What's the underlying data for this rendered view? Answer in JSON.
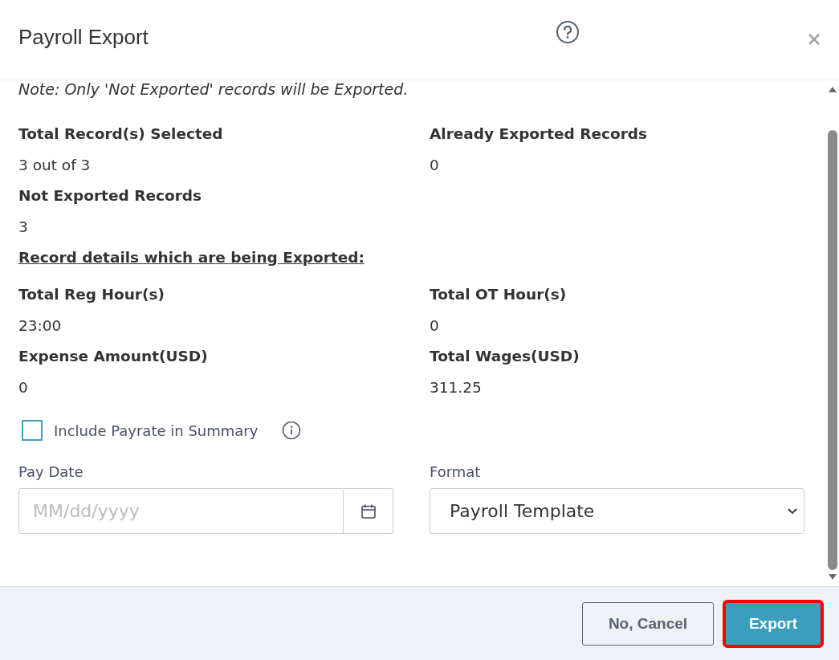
{
  "dialog": {
    "title": "Payroll Export"
  },
  "note": "Note: Only 'Not Exported' records will be Exported.",
  "summary": [
    {
      "label": "Total Record(s) Selected",
      "value": "3 out of 3"
    },
    {
      "label": "Already Exported Records",
      "value": "0"
    },
    {
      "label": "Not Exported Records",
      "value": "3"
    }
  ],
  "details_heading": "Record details which are being Exported:",
  "details": [
    {
      "label": "Total Reg Hour(s)",
      "value": "23:00"
    },
    {
      "label": "Total OT Hour(s)",
      "value": "0"
    },
    {
      "label": "Expense Amount(USD)",
      "value": "0"
    },
    {
      "label": "Total Wages(USD)",
      "value": "311.25"
    }
  ],
  "include_payrate": {
    "label": "Include Payrate in Summary",
    "checked": false
  },
  "pay_date": {
    "label": "Pay Date",
    "placeholder": "MM/dd/yyyy"
  },
  "format": {
    "label": "Format",
    "value": "Payroll Template"
  },
  "buttons": [
    {
      "label": "No, Cancel",
      "kind": "secondary",
      "highlighted": false
    },
    {
      "label": "Export",
      "kind": "primary",
      "highlighted": true
    }
  ]
}
